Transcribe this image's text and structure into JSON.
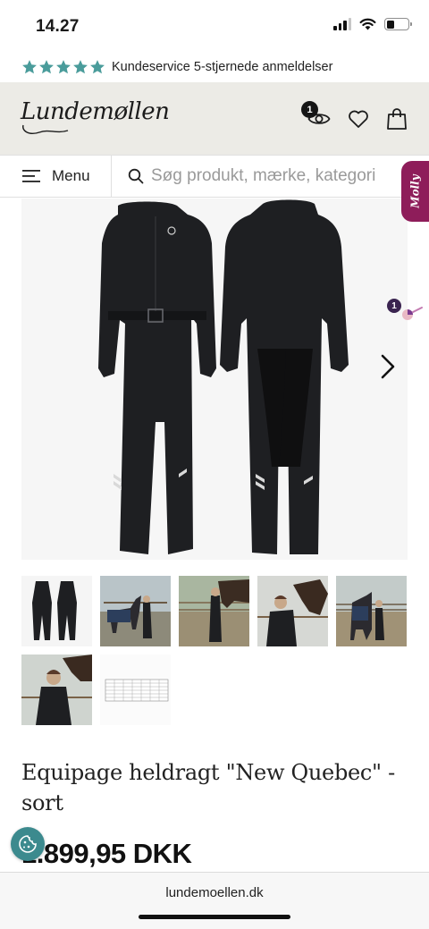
{
  "status_bar": {
    "time": "14.27",
    "battery_level": 0.35
  },
  "rating_strip": {
    "stars": 5,
    "star_color": "#4a9c9b",
    "text": "Kundeservice 5-stjernede anmeldelser"
  },
  "header": {
    "logo_text": "Lundemøllen",
    "viewed_count": "1",
    "icons": [
      "eye-icon",
      "heart-icon",
      "shopping-bag-icon"
    ]
  },
  "searchbar": {
    "menu_label": "Menu",
    "search_placeholder": "Søg produkt, mærke, kategori"
  },
  "chat_tab": {
    "label": "Molly",
    "color": "#8e1d5a"
  },
  "gallery": {
    "side_badge": "1",
    "thumbnail_count": 7
  },
  "product": {
    "title": "Equipage heldragt \"New Quebec\" - sort",
    "price": "1.899,95 DKK"
  },
  "browser": {
    "url": "lundemoellen.dk"
  }
}
